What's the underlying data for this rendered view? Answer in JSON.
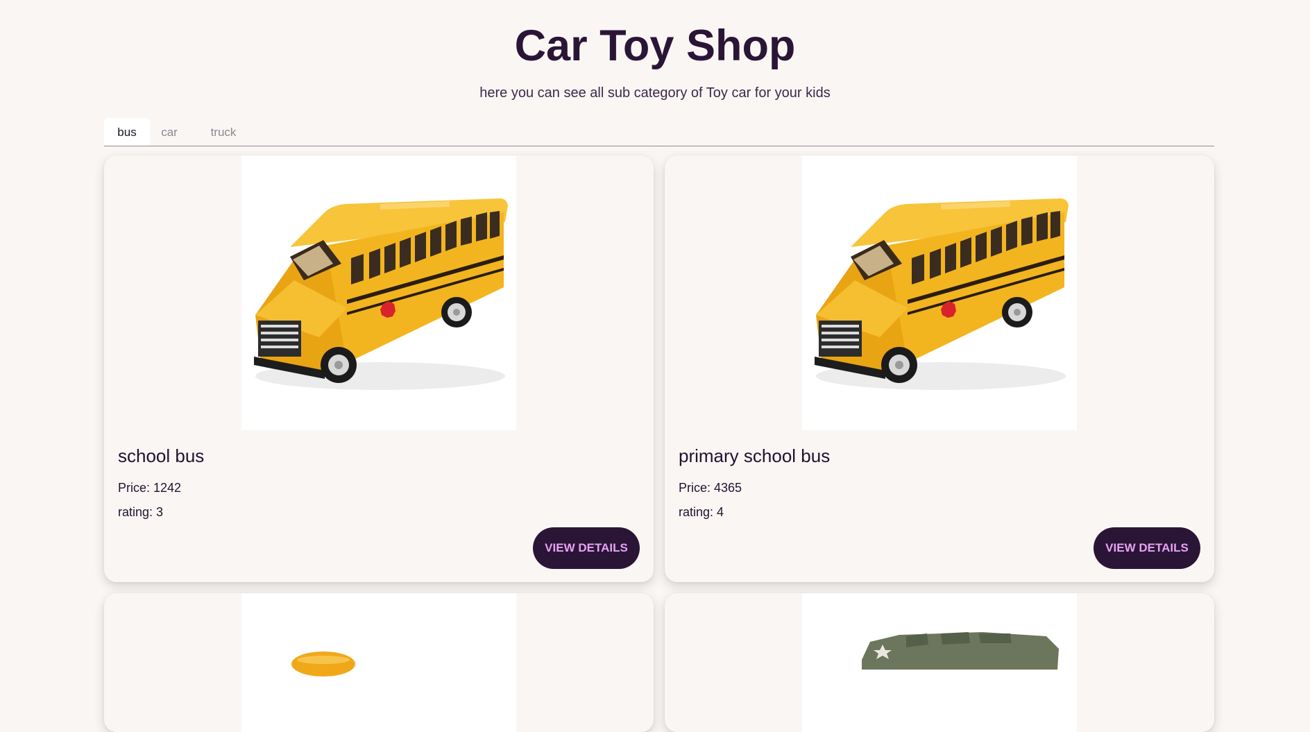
{
  "header": {
    "title": "Car Toy Shop",
    "subtitle": "here you can see all sub category of Toy car for your kids"
  },
  "tabs": [
    {
      "label": "bus",
      "active": true
    },
    {
      "label": "car",
      "active": false
    },
    {
      "label": "truck",
      "active": false
    }
  ],
  "products": [
    {
      "name": "school bus",
      "price_text": "Price: 1242",
      "rating_text": "rating: 3",
      "button_label": "VIEW DETAILS",
      "image": "yellow-school-bus"
    },
    {
      "name": "primary school bus",
      "price_text": "Price: 4365",
      "rating_text": "rating: 4",
      "button_label": "VIEW DETAILS",
      "image": "yellow-school-bus"
    },
    {
      "image": "yellow-toy-partial"
    },
    {
      "image": "army-truck-partial"
    }
  ],
  "colors": {
    "background": "#faf6f4",
    "primary": "#2a1537",
    "button_text": "#e7a3f4",
    "bus_yellow": "#f2b51f",
    "army_green": "#6b765c"
  }
}
